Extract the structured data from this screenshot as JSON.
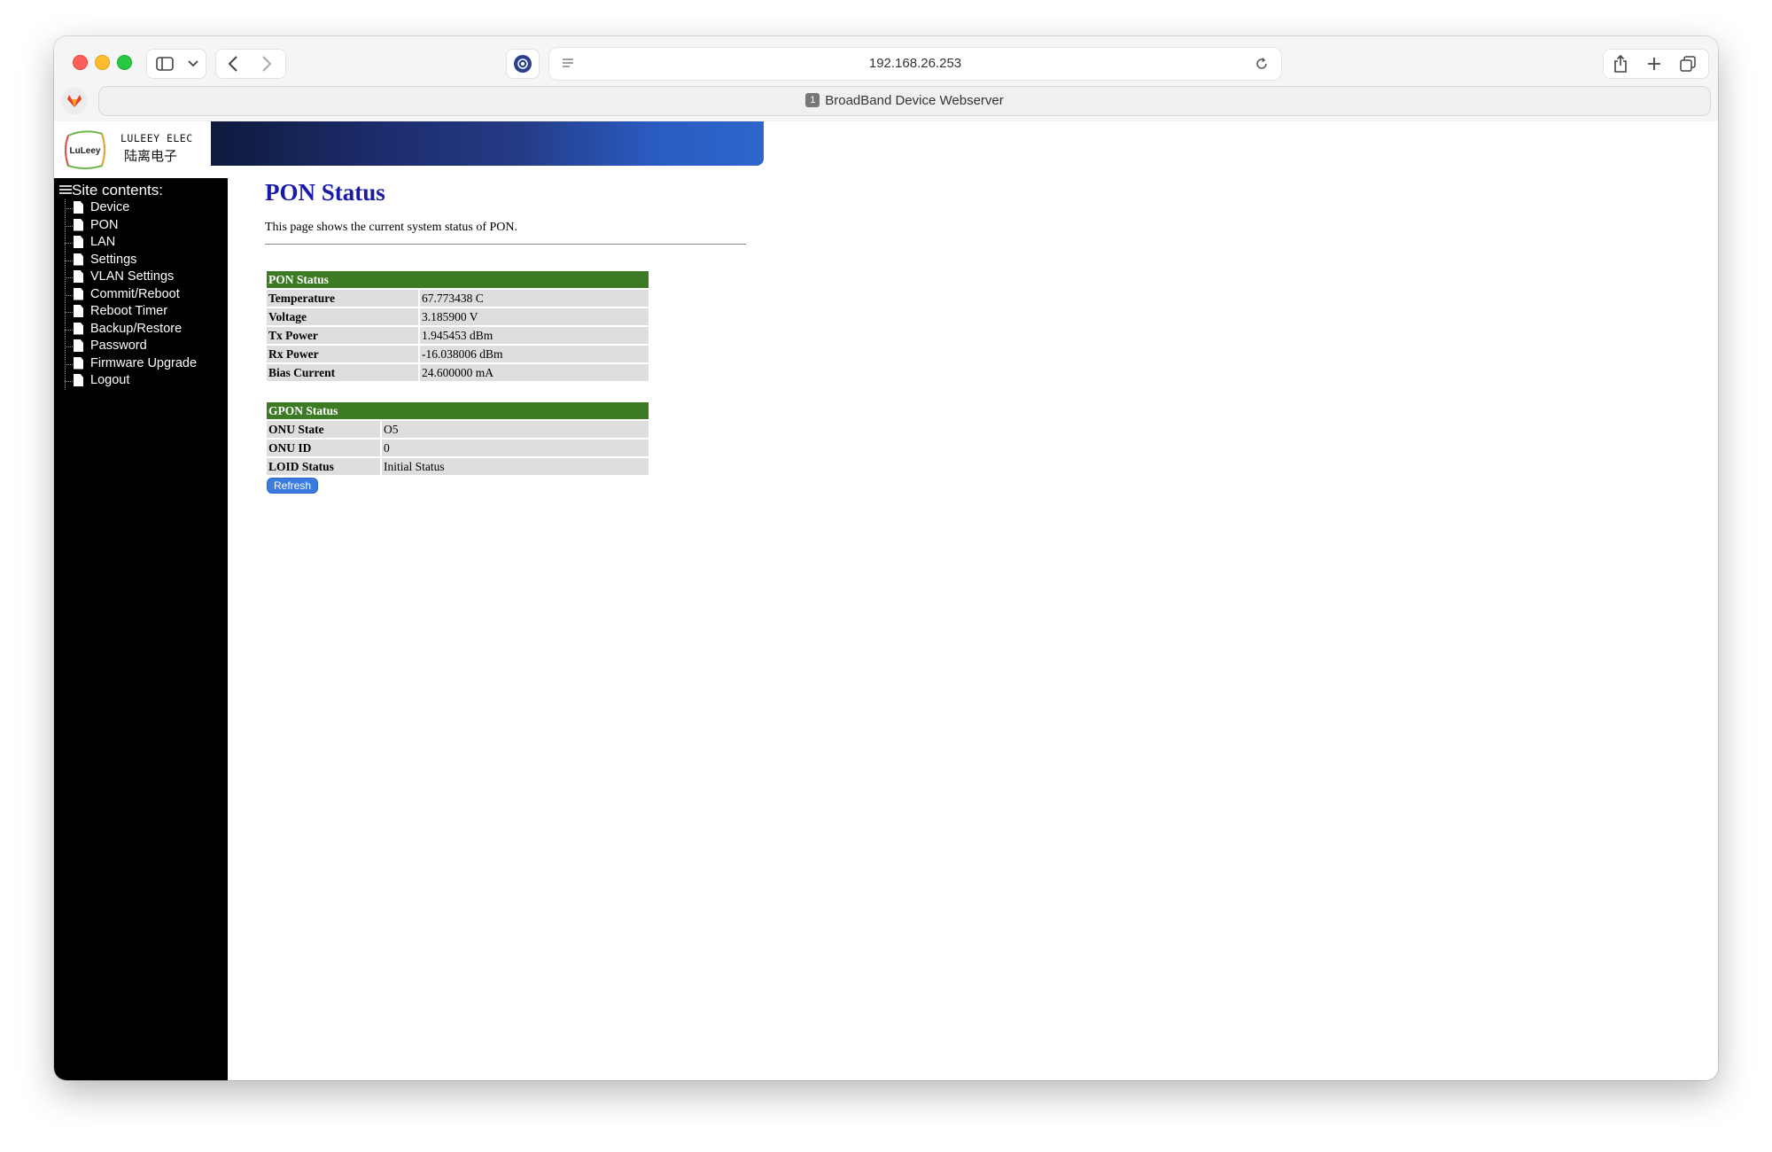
{
  "browser": {
    "url": "192.168.26.253",
    "tab_title": "BroadBand Device Webserver",
    "tab_index": "1"
  },
  "logo": {
    "brand_en": "LULEEY ELEC",
    "brand_cn": "陆离电子",
    "badge": "LuLeey"
  },
  "sidebar": {
    "title": "Site contents:",
    "items": [
      {
        "label": "Device"
      },
      {
        "label": "PON"
      },
      {
        "label": "LAN"
      },
      {
        "label": "Settings"
      },
      {
        "label": "VLAN Settings"
      },
      {
        "label": "Commit/Reboot"
      },
      {
        "label": "Reboot Timer"
      },
      {
        "label": "Backup/Restore"
      },
      {
        "label": "Password"
      },
      {
        "label": "Firmware Upgrade"
      },
      {
        "label": "Logout"
      }
    ]
  },
  "main": {
    "title": "PON Status",
    "description": "This page shows the current system status of PON.",
    "pon_table": {
      "header": "PON Status",
      "rows": [
        {
          "label": "Temperature",
          "value": "67.773438 C"
        },
        {
          "label": "Voltage",
          "value": "3.185900 V"
        },
        {
          "label": "Tx Power",
          "value": "1.945453 dBm"
        },
        {
          "label": "Rx Power",
          "value": "-16.038006 dBm"
        },
        {
          "label": "Bias Current",
          "value": "24.600000 mA"
        }
      ]
    },
    "gpon_table": {
      "header": "GPON Status",
      "rows": [
        {
          "label": "ONU State",
          "value": "O5"
        },
        {
          "label": "ONU ID",
          "value": "0"
        },
        {
          "label": "LOID Status",
          "value": "Initial Status"
        }
      ]
    },
    "refresh_label": "Refresh"
  },
  "colors": {
    "title": "#1a1aa8",
    "table_header": "#3d7a24",
    "cell_bg": "#dedede",
    "button": "#3a7be0"
  }
}
